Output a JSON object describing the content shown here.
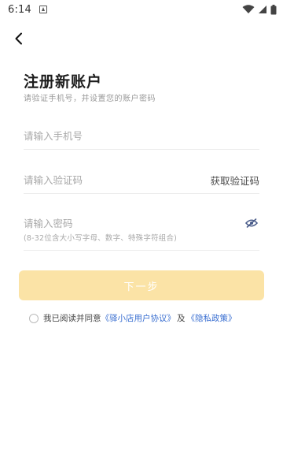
{
  "status_bar": {
    "time": "6:14",
    "icons": [
      "app-notification-icon",
      "wifi-icon",
      "cell-signal-icon",
      "battery-icon"
    ]
  },
  "header": {
    "back_icon": "chevron-left-icon"
  },
  "page": {
    "title": "注册新账户",
    "subtitle": "请验证手机号，并设置您的账户密码"
  },
  "form": {
    "phone": {
      "value": "",
      "placeholder": "请输入手机号"
    },
    "code": {
      "value": "",
      "placeholder": "请输入验证码",
      "action_label": "获取验证码"
    },
    "password": {
      "value": "",
      "placeholder": "请输入密码",
      "hint": "(8-32位含大小写字母、数字、特殊字符组合)",
      "toggle_icon": "eye-icon"
    }
  },
  "next_button": {
    "label": "下一步",
    "color": "#fbe3a6"
  },
  "agreement": {
    "prefix": "我已阅读并同意",
    "user_agreement": "《驿小店用户协议》",
    "conjunction": "及",
    "privacy_policy": "《隐私政策》",
    "checked": false,
    "link_color": "#3a6fd1"
  }
}
